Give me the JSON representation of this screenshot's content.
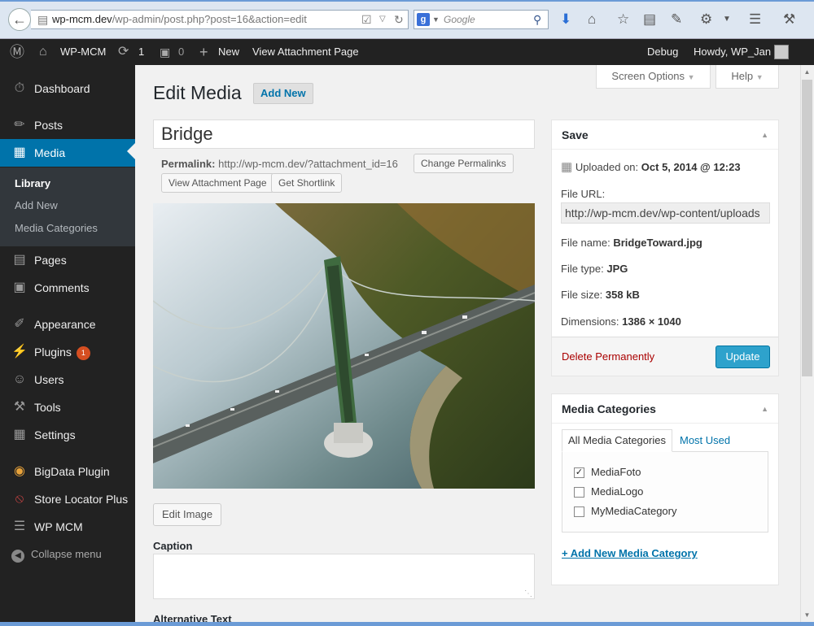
{
  "browser": {
    "url_host": "wp-mcm.dev",
    "url_path": "/wp-admin/post.php?post=16&action=edit",
    "search_placeholder": "Google"
  },
  "adminbar": {
    "site_name": "WP-MCM",
    "updates_count": "1",
    "comments_count": "0",
    "new_label": "New",
    "view_attachment": "View Attachment Page",
    "debug": "Debug",
    "howdy": "Howdy, WP_Jan"
  },
  "sidebar": {
    "items": [
      {
        "label": "Dashboard",
        "icon": "dashboard-icon"
      },
      {
        "label": "Posts",
        "icon": "pin-icon"
      },
      {
        "label": "Media",
        "icon": "media-icon"
      },
      {
        "label": "Pages",
        "icon": "pages-icon"
      },
      {
        "label": "Comments",
        "icon": "comments-icon"
      },
      {
        "label": "Appearance",
        "icon": "brush-icon"
      },
      {
        "label": "Plugins",
        "icon": "plugin-icon",
        "badge": "1"
      },
      {
        "label": "Users",
        "icon": "users-icon"
      },
      {
        "label": "Tools",
        "icon": "wrench-icon"
      },
      {
        "label": "Settings",
        "icon": "settings-icon"
      },
      {
        "label": "BigData Plugin",
        "icon": "bulb-icon"
      },
      {
        "label": "Store Locator Plus",
        "icon": "no-location-icon"
      },
      {
        "label": "WP MCM",
        "icon": "list-icon"
      }
    ],
    "submenu": [
      "Library",
      "Add New",
      "Media Categories"
    ],
    "collapse": "Collapse menu"
  },
  "main": {
    "screen_options": "Screen Options",
    "help": "Help",
    "title": "Edit Media",
    "add_new": "Add New",
    "post_title": "Bridge",
    "permalink_label": "Permalink:",
    "permalink_url": "http://wp-mcm.dev/?attachment_id=16",
    "change_permalinks": "Change Permalinks",
    "view_attachment_page": "View Attachment Page",
    "get_shortlink": "Get Shortlink",
    "edit_image": "Edit Image",
    "caption_label": "Caption",
    "alt_text_label": "Alternative Text"
  },
  "save_box": {
    "title": "Save",
    "uploaded_label": "Uploaded on:",
    "uploaded_value": "Oct 5, 2014 @ 12:23",
    "file_url_label": "File URL:",
    "file_url_value": "http://wp-mcm.dev/wp-content/uploads",
    "file_name_label": "File name:",
    "file_name_value": "BridgeToward.jpg",
    "file_type_label": "File type:",
    "file_type_value": "JPG",
    "file_size_label": "File size:",
    "file_size_value": "358 kB",
    "dimensions_label": "Dimensions:",
    "dimensions_value": "1386 × 1040",
    "delete": "Delete Permanently",
    "update": "Update"
  },
  "media_categories": {
    "title": "Media Categories",
    "tab_all": "All Media Categories",
    "tab_most_used": "Most Used",
    "items": [
      {
        "label": "MediaFoto",
        "checked": true
      },
      {
        "label": "MediaLogo",
        "checked": false
      },
      {
        "label": "MyMediaCategory",
        "checked": false
      }
    ],
    "add_new": "+ Add New Media Category"
  },
  "colors": {
    "admin_bar": "#222222",
    "accent": "#0073aa",
    "update_button": "#2ea2cc",
    "delete": "#aa0000"
  }
}
